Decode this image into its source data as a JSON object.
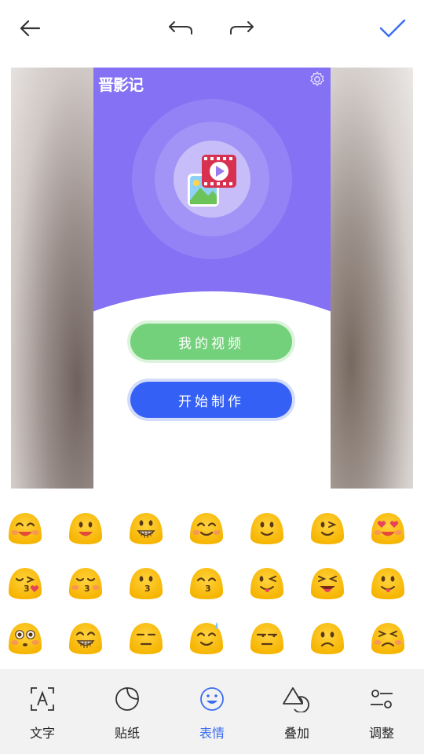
{
  "top_bar": {
    "back_icon": "arrow-left-icon",
    "undo_icon": "undo-icon",
    "redo_icon": "redo-icon",
    "confirm_icon": "checkmark-icon",
    "accent": "#3b6df0"
  },
  "preview": {
    "app": {
      "brand_title": "晋影记",
      "settings_icon": "gear-icon",
      "buttons": {
        "my_videos": "我的视频",
        "start_making": "开始制作"
      },
      "colors": {
        "header": "#8471f4",
        "green": "#74d17b",
        "blue": "#3460f6"
      }
    }
  },
  "emoji_panel": {
    "emojis": [
      "grinning-squint-face",
      "smiling-face-open-mouth",
      "grinning-teeth-face",
      "smiling-closed-eyes-face",
      "slightly-smiling-face",
      "winking-face",
      "heart-eyes-face",
      "kissing-heart-face",
      "kissing-blush-face",
      "kissing-face",
      "kissing-smiling-eyes-face",
      "winking-tongue-face",
      "squinting-tongue-face",
      "tongue-out-face",
      "flushed-face",
      "grimacing-grin-face",
      "expressionless-face",
      "sweat-smile-face",
      "unamused-face",
      "frowning-face",
      "persevering-face"
    ]
  },
  "bottom_tabs": {
    "items": [
      {
        "label": "文字",
        "icon": "text-box-icon"
      },
      {
        "label": "贴纸",
        "icon": "sticker-icon"
      },
      {
        "label": "表情",
        "icon": "emoji-icon"
      },
      {
        "label": "叠加",
        "icon": "overlay-shapes-icon"
      },
      {
        "label": "调整",
        "icon": "adjust-sliders-icon"
      }
    ],
    "active": "表情"
  }
}
